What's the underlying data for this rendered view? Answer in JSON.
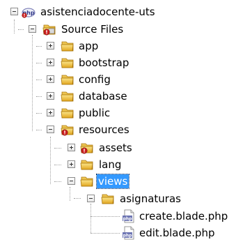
{
  "tree": {
    "project": {
      "label": "asistenciadocente-uts",
      "icon": "php-project-icon"
    },
    "source_files": {
      "label": "Source Files",
      "icon": "source-package-icon"
    },
    "folders": {
      "app": {
        "label": "app"
      },
      "bootstrap": {
        "label": "bootstrap"
      },
      "config": {
        "label": "config"
      },
      "database": {
        "label": "database"
      },
      "public": {
        "label": "public"
      },
      "resources": {
        "label": "resources"
      },
      "assets": {
        "label": "assets"
      },
      "lang": {
        "label": "lang"
      },
      "views": {
        "label": "views",
        "selected": true
      },
      "asignaturas": {
        "label": "asignaturas"
      }
    },
    "files": {
      "create": {
        "label": "create.blade.php",
        "icon": "php-file-icon"
      },
      "edit": {
        "label": "edit.blade.php",
        "icon": "php-file-icon"
      }
    }
  },
  "colors": {
    "selection": "#3399ff",
    "folder": "#f2c94c",
    "error_badge": "#cc1f1f"
  }
}
